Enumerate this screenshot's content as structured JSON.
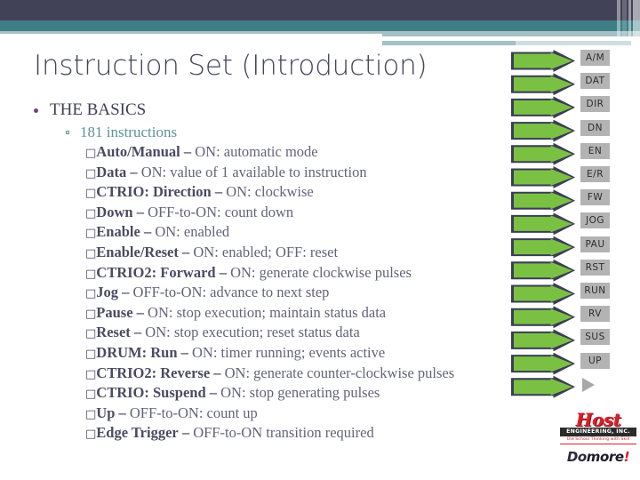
{
  "slide": {
    "title": "Instruction Set (Introduction)"
  },
  "theme": {
    "navy": "#414257",
    "teal": "#3d7f85",
    "light_teal": "#a3c0c4",
    "title_color": "#44455c",
    "bullet_purple": "#76407a",
    "sub_bullet_teal": "#5c9397",
    "body_color": "#5a5a72",
    "arrow_green": "#7ac143",
    "arrow_outline": "#3b3c55",
    "label_gray": "#b3b3b3",
    "logo_red": "#d8202a"
  },
  "body": {
    "level1": "THE BASICS",
    "level2": "181 instructions",
    "items": [
      {
        "box": "□",
        "term": "Auto/Manual",
        "dash": "–",
        "desc": "ON: automatic mode"
      },
      {
        "box": "□",
        "term": "Data",
        "dash": "–",
        "desc": "ON: value of 1 available to instruction"
      },
      {
        "box": "□",
        "term": "CTRIO: Direction",
        "dash": "–",
        "desc": "ON: clockwise"
      },
      {
        "box": "□",
        "term": "Down",
        "dash": "–",
        "desc": "OFF-to-ON: count down"
      },
      {
        "box": "□",
        "term": "Enable",
        "dash": "–",
        "desc": "ON: enabled"
      },
      {
        "box": "□",
        "term": "Enable/Reset",
        "dash": "–",
        "desc": "ON: enabled; OFF: reset"
      },
      {
        "box": "□",
        "term": "CTRIO2: Forward",
        "dash": "–",
        "desc": "ON: generate clockwise pulses"
      },
      {
        "box": "□",
        "term": "Jog",
        "dash": "–",
        "desc": "OFF-to-ON: advance to next step"
      },
      {
        "box": "□",
        "term": "Pause",
        "dash": "–",
        "desc": "ON: stop execution; maintain status data"
      },
      {
        "box": "□",
        "term": "Reset",
        "dash": "–",
        "desc": "ON: stop execution; reset status data"
      },
      {
        "box": "□",
        "term": "DRUM: Run",
        "dash": "–",
        "desc": "ON: timer running; events active"
      },
      {
        "box": "□",
        "term": "CTRIO2: Reverse",
        "dash": "–",
        "desc": "ON: generate counter-clockwise pulses"
      },
      {
        "box": "□",
        "term": "CTRIO: Suspend",
        "dash": "–",
        "desc": "ON: stop generating pulses"
      },
      {
        "box": "□",
        "term": "Up",
        "dash": "–",
        "desc": "OFF-to-ON: count up"
      },
      {
        "box": "□",
        "term": "Edge Trigger",
        "dash": "–",
        "desc": "OFF-to-ON transition required"
      }
    ]
  },
  "arrows": [
    {
      "label": "A/M"
    },
    {
      "label": "DAT"
    },
    {
      "label": "DIR"
    },
    {
      "label": "DN"
    },
    {
      "label": "EN"
    },
    {
      "label": "E/R"
    },
    {
      "label": "FW"
    },
    {
      "label": "JOG"
    },
    {
      "label": "PAU"
    },
    {
      "label": "RST"
    },
    {
      "label": "RUN"
    },
    {
      "label": "RV"
    },
    {
      "label": "SUS"
    },
    {
      "label": "UP"
    },
    {
      "label": ""
    }
  ],
  "logo": {
    "host": "Host",
    "engineering": "ENGINEERING, INC.",
    "tagline": "Old School Thinking with Skill",
    "do": "Do",
    "more": "more",
    "bang": "!"
  }
}
